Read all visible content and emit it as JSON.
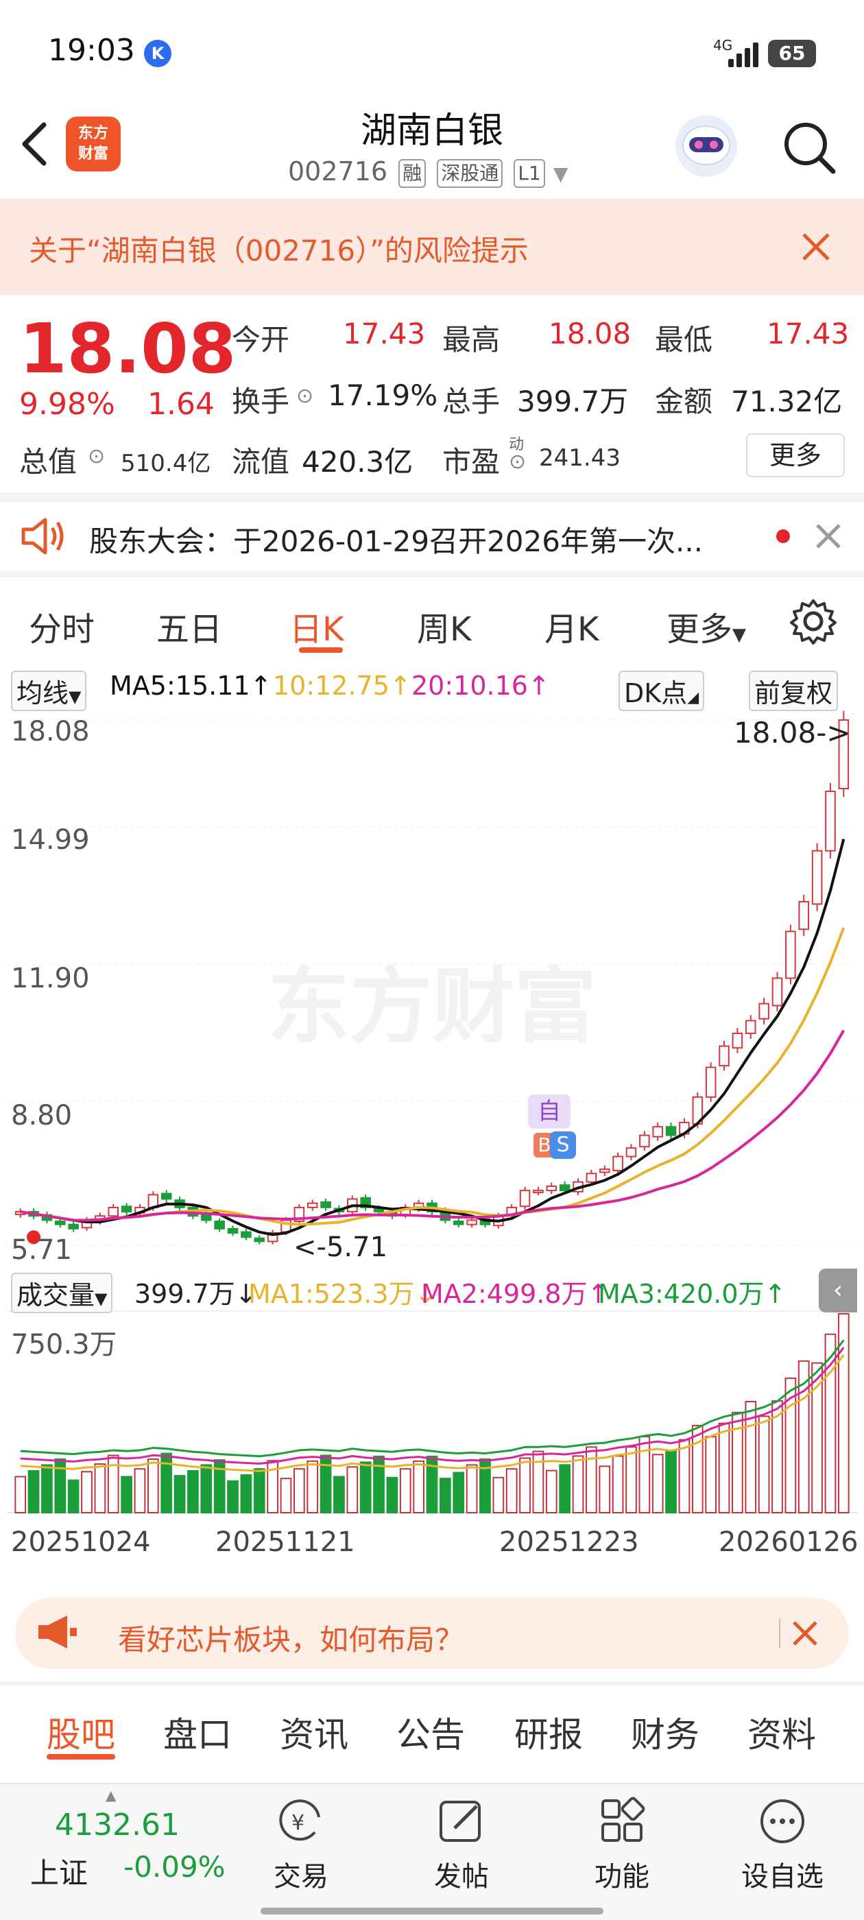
{
  "status_bar": {
    "time": "19:03",
    "network": "4G",
    "battery": "65"
  },
  "header": {
    "logo_text": "东方\n财富",
    "title": "湖南白银",
    "code": "002716",
    "tags": [
      "融",
      "深股通",
      "L1"
    ]
  },
  "risk_notice": {
    "text": "关于“湖南白银（002716）”的风险提示"
  },
  "quote": {
    "price": "18.08",
    "change_pct": "9.98%",
    "change": "1.64",
    "open_label": "今开",
    "open": "17.43",
    "high_label": "最高",
    "high": "18.08",
    "low_label": "最低",
    "low": "17.43",
    "turnover_label": "换手",
    "turnover": "17.19%",
    "volume_label": "总手",
    "volume": "399.7万",
    "amount_label": "金额",
    "amount": "71.32亿",
    "mktcap_label": "总值",
    "mktcap": "510.4亿",
    "float_label": "流值",
    "float": "420.3亿",
    "pe_label": "市盈",
    "pe_sup": "动",
    "pe": "241.43",
    "more_label": "更多"
  },
  "announcement": {
    "text": "股东大会：于2026-01-29召开2026年第一次..."
  },
  "period_tabs": [
    "分时",
    "五日",
    "日K",
    "周K",
    "月K",
    "更多"
  ],
  "active_period": "日K",
  "ma_bar": {
    "selector": "均线",
    "ma5": "MA5:15.11↑",
    "ma10": "10:12.75↑",
    "ma20": "20:10.16↑",
    "dk": "DK点",
    "adjust": "前复权",
    "colors": {
      "ma5": "#111111",
      "ma10": "#e8b32a",
      "ma20": "#d9259b"
    }
  },
  "price_axis": [
    "18.08",
    "14.99",
    "11.90",
    "8.80",
    "5.71"
  ],
  "annotations": {
    "last_price": "18.08->",
    "low_marker": "<-5.71",
    "self_tag": "自",
    "b_tag": "B",
    "s_tag": "S"
  },
  "watermark": "东方财富",
  "volume_bar": {
    "selector": "成交量",
    "vol": "399.7万↓",
    "ma1": "MA1:523.3万↓",
    "ma2": "MA2:499.8万↑",
    "ma3": "MA3:420.0万↑",
    "max_label": "750.3万"
  },
  "date_axis": [
    "20251024",
    "20251121",
    "20251223",
    "20260126"
  ],
  "chart_data": {
    "type": "candlestick",
    "price_range": [
      5.71,
      18.08
    ],
    "candles_close": [
      6.5,
      6.4,
      6.3,
      6.2,
      6.1,
      6.3,
      6.4,
      6.6,
      6.5,
      6.6,
      6.9,
      6.8,
      6.6,
      6.4,
      6.3,
      6.1,
      6.0,
      5.9,
      5.8,
      6.0,
      6.3,
      6.6,
      6.7,
      6.6,
      6.5,
      6.8,
      6.6,
      6.5,
      6.4,
      6.6,
      6.7,
      6.5,
      6.3,
      6.2,
      6.3,
      6.2,
      6.4,
      6.6,
      7.0,
      7.0,
      7.1,
      7.0,
      7.2,
      7.4,
      7.5,
      7.8,
      8.0,
      8.3,
      8.5,
      8.3,
      8.6,
      9.2,
      9.9,
      10.4,
      10.7,
      11.0,
      11.4,
      12.0,
      13.1,
      13.8,
      15.0,
      16.4,
      18.08
    ],
    "ma5_end": "15.11",
    "ma10_end": "12.75",
    "ma20_end": "10.16",
    "volume_max": "750.3万"
  },
  "promo_banner": {
    "text": "看好芯片板块，如何布局？"
  },
  "bottom_tabs": [
    "股吧",
    "盘口",
    "资讯",
    "公告",
    "研报",
    "财务",
    "资料"
  ],
  "index_ticker": {
    "value": "4132.61",
    "name": "上证",
    "pct": "-0.09%"
  },
  "nav": {
    "trade": "交易",
    "post": "发帖",
    "func": "功能",
    "watch": "设自选"
  }
}
